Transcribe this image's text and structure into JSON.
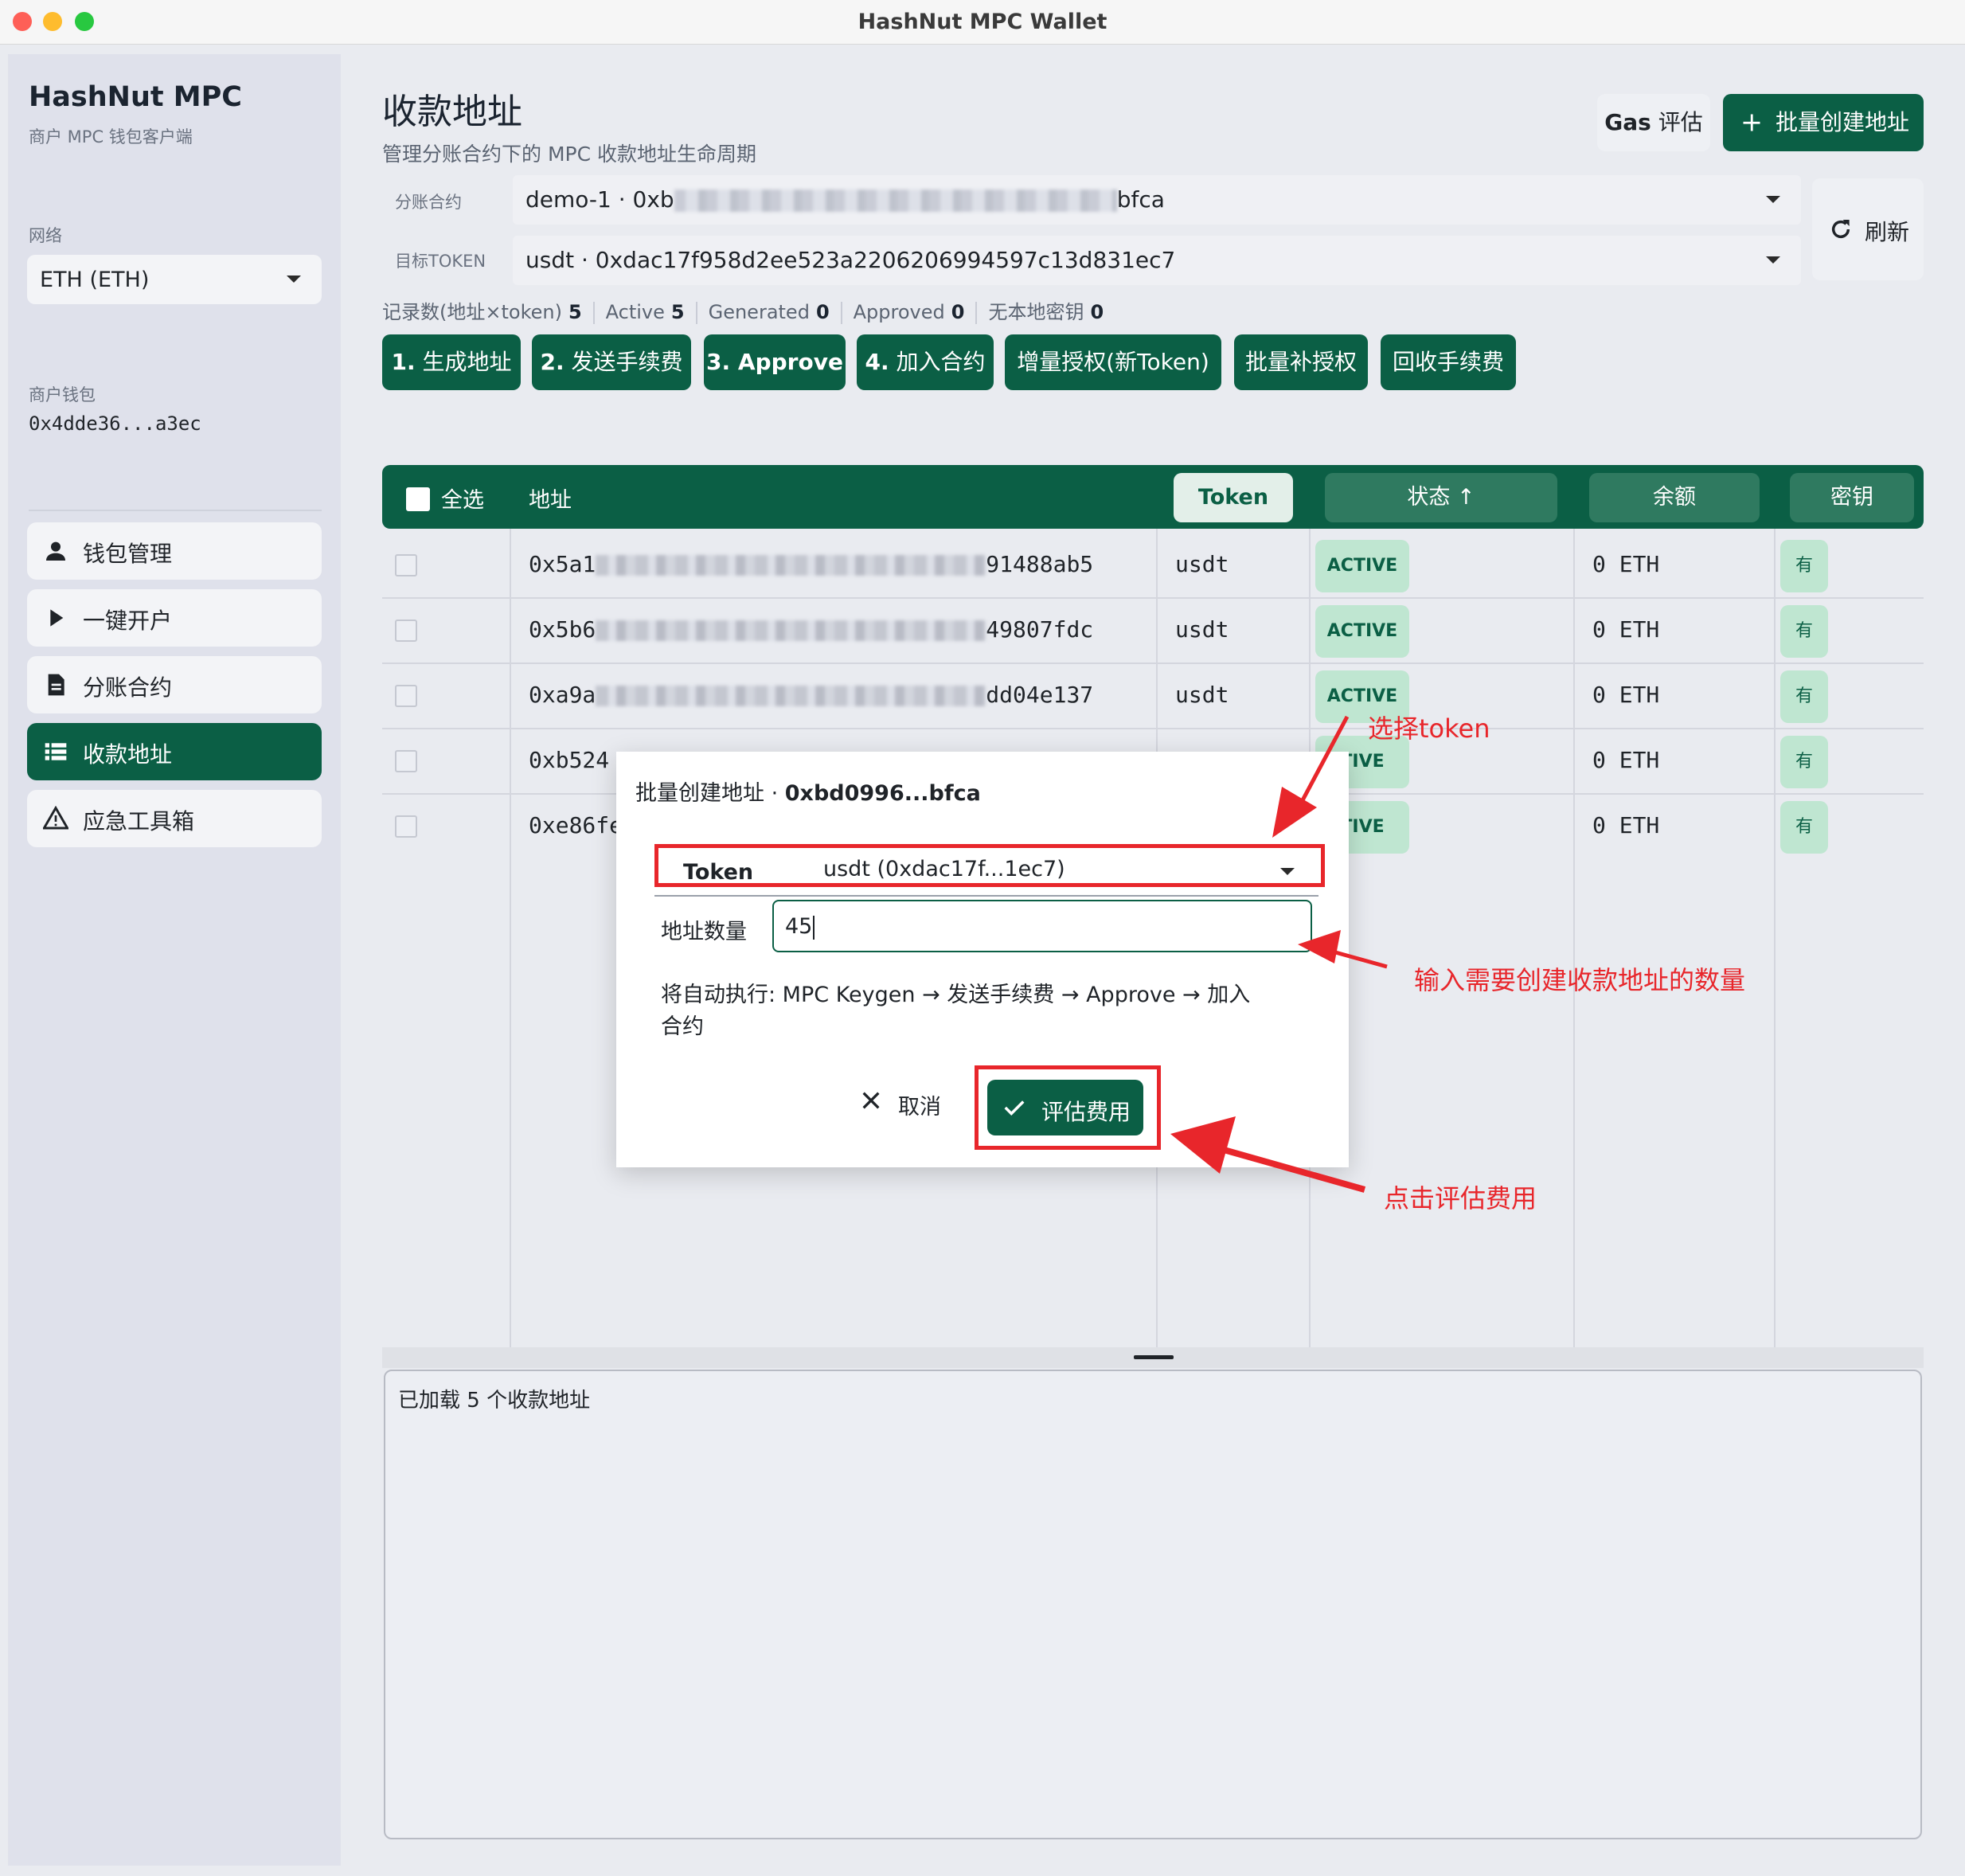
{
  "window": {
    "title": "HashNut MPC Wallet"
  },
  "sidebar": {
    "brand": "HashNut MPC",
    "brand_sub": "商户 MPC 钱包客户端",
    "network_label": "网络",
    "network_value": "ETH (ETH)",
    "wallet_label": "商户钱包",
    "wallet_address": "0x4dde36...a3ec",
    "items": [
      {
        "label": "钱包管理",
        "icon": "user-icon"
      },
      {
        "label": "一键开户",
        "icon": "play-icon"
      },
      {
        "label": "分账合约",
        "icon": "document-icon"
      },
      {
        "label": "收款地址",
        "icon": "list-icon",
        "active": true
      },
      {
        "label": "应急工具箱",
        "icon": "warning-icon"
      }
    ]
  },
  "header": {
    "title": "收款地址",
    "subtitle": "管理分账合约下的 MPC 收款地址生命周期",
    "gas_label_bold": "Gas",
    "gas_label_rest": " 评估",
    "batch_label": "批量创建地址",
    "refresh_label": "刷新"
  },
  "filters": {
    "contract_label": "分账合约",
    "contract_value_prefix": "demo-1 · 0xb",
    "contract_value_suffix": "bfca",
    "token_label": "目标TOKEN",
    "token_value": "usdt · 0xdac17f958d2ee523a2206206994597c13d831ec7"
  },
  "stats": [
    {
      "label": "记录数(地址×token)",
      "value": "5"
    },
    {
      "label": "Active",
      "value": "5"
    },
    {
      "label": "Generated",
      "value": "0"
    },
    {
      "label": "Approved",
      "value": "0"
    },
    {
      "label": "无本地密钥",
      "value": "0"
    }
  ],
  "steps": [
    {
      "num": "1.",
      "label": " 生成地址"
    },
    {
      "num": "2.",
      "label": " 发送手续费"
    },
    {
      "num": "3.",
      "label": " Approve"
    },
    {
      "num": "4.",
      "label": " 加入合约"
    },
    {
      "num": "",
      "label": "增量授权(新Token)"
    },
    {
      "num": "",
      "label": "批量补授权"
    },
    {
      "num": "",
      "label": "回收手续费"
    }
  ],
  "table": {
    "select_all": "全选",
    "col_address": "地址",
    "col_token": "Token",
    "col_status": "状态 ↑",
    "col_balance": "余额",
    "col_key": "密钥",
    "rows": [
      {
        "addr_start": "0x5a1",
        "addr_end": "91488ab5",
        "token": "usdt",
        "status": "ACTIVE",
        "balance": "0 ETH",
        "key": "有"
      },
      {
        "addr_start": "0x5b6",
        "addr_end": "49807fdc",
        "token": "usdt",
        "status": "ACTIVE",
        "balance": "0 ETH",
        "key": "有"
      },
      {
        "addr_start": "0xa9a",
        "addr_end": "dd04e137",
        "token": "usdt",
        "status": "ACTIVE",
        "balance": "0 ETH",
        "key": "有"
      },
      {
        "addr_start": "0xb524",
        "addr_end": "",
        "token": "",
        "status": "TIVE",
        "balance": "0 ETH",
        "key": "有"
      },
      {
        "addr_start": "0xe86fe",
        "addr_end": "",
        "token": "",
        "status": "TIVE",
        "balance": "0 ETH",
        "key": "有"
      }
    ]
  },
  "log": {
    "text": "已加载 5  个收款地址"
  },
  "modal": {
    "title_prefix": "批量创建地址 · ",
    "title_contract": "0xbd0996...bfca",
    "token_label": "Token",
    "token_value": "usdt (0xdac17f...1ec7)",
    "quantity_label": "地址数量",
    "quantity_value": "45",
    "description": "将自动执行: MPC Keygen → 发送手续费 → Approve → 加入合约",
    "cancel_label": "取消",
    "estimate_label": "评估费用"
  },
  "annotations": {
    "select_token": "选择token",
    "enter_quantity": "输入需要创建收款地址的数量",
    "click_estimate": "点击评估费用",
    "color": "#e8262b"
  },
  "colors": {
    "primary": "#0b5f45",
    "badge": "#bfe6d1"
  }
}
